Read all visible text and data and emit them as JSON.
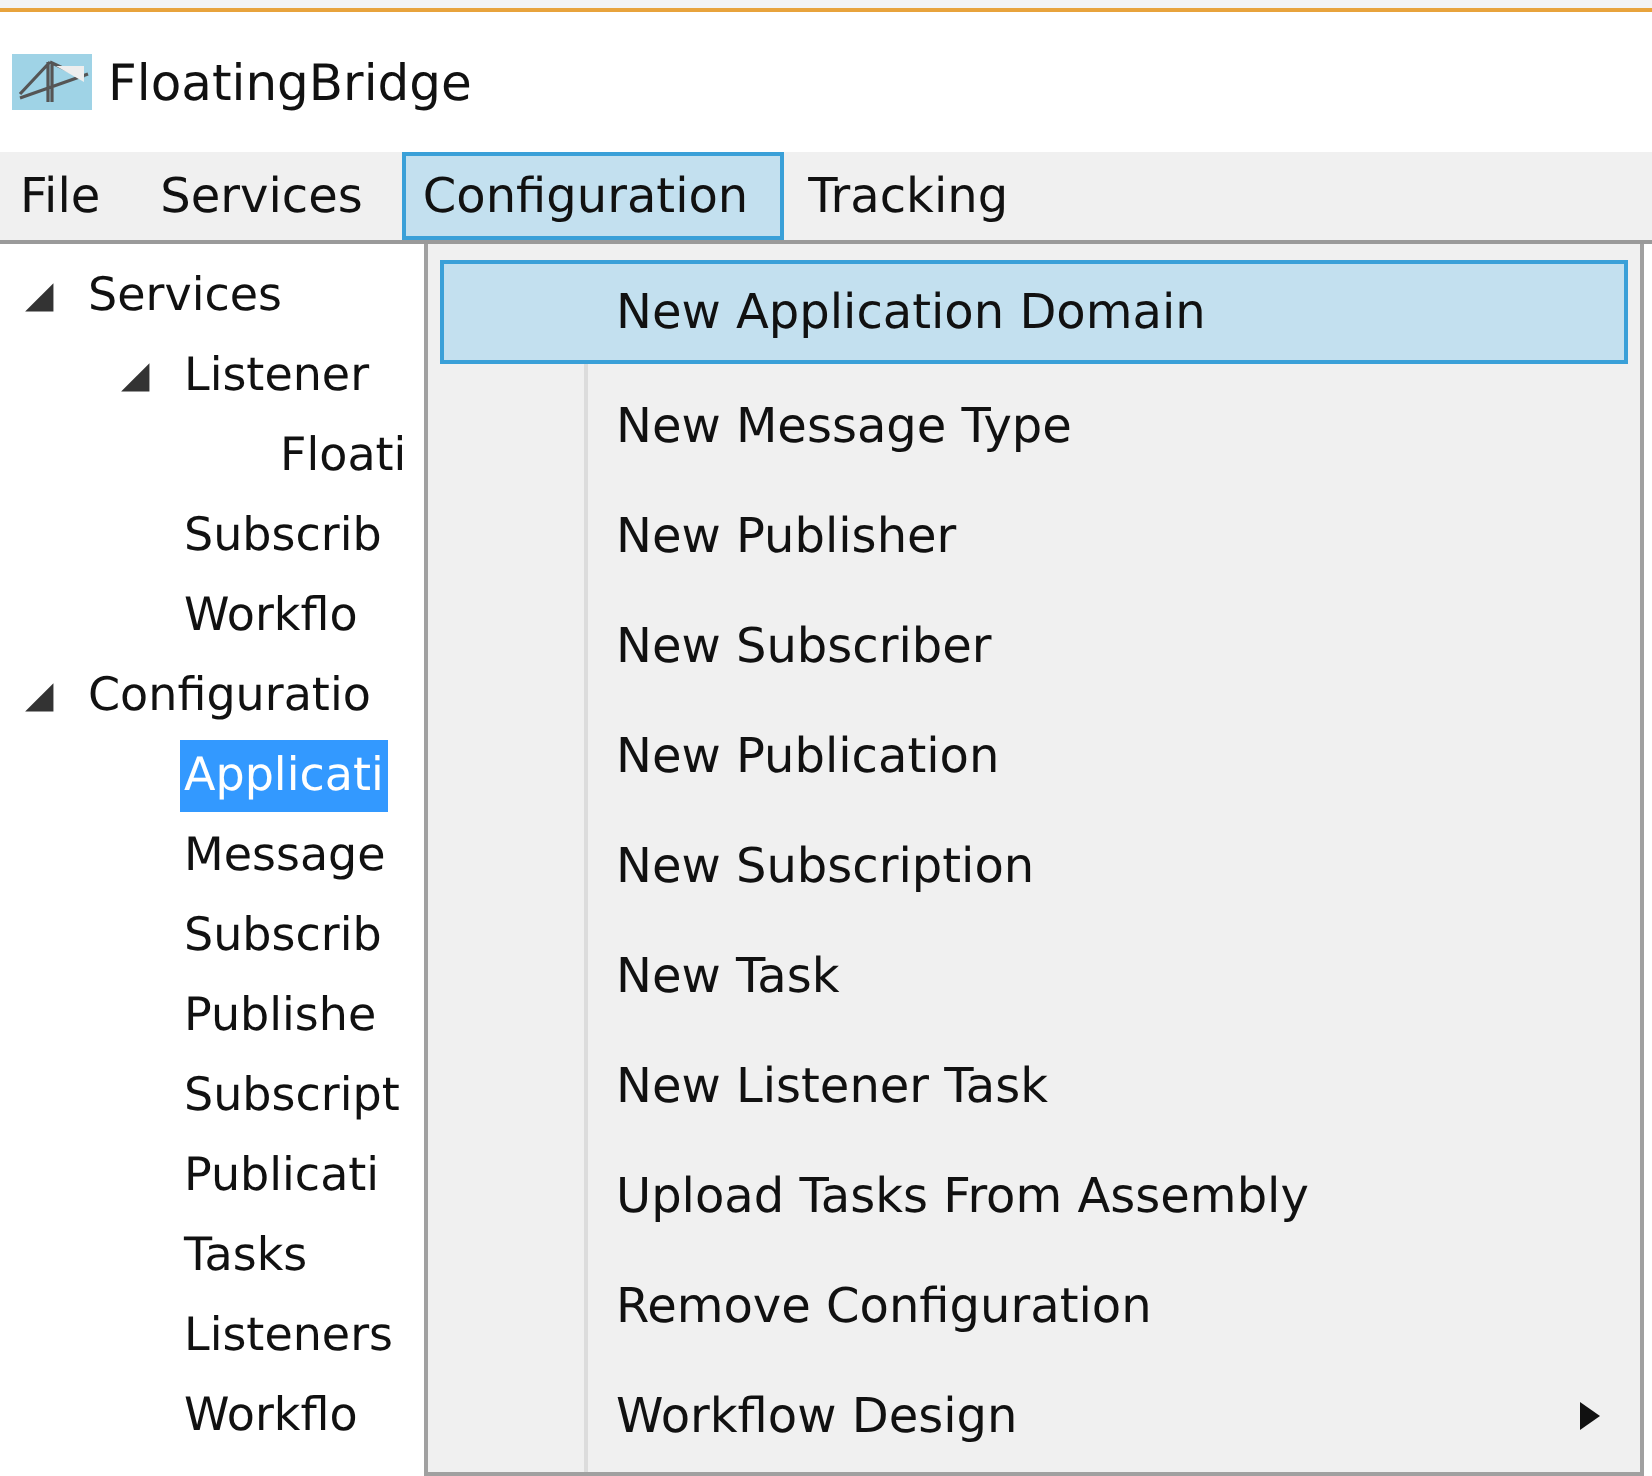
{
  "window": {
    "title": "FloatingBridge"
  },
  "menu_bar": [
    {
      "label": "File",
      "selected": false
    },
    {
      "label": "Services",
      "selected": false
    },
    {
      "label": "Configuration",
      "selected": true
    },
    {
      "label": "Tracking",
      "selected": false
    }
  ],
  "tree": [
    {
      "label": "Services",
      "expanded": true,
      "selected": false,
      "children": [
        {
          "label": "Listener",
          "expanded": true,
          "selected": false,
          "children": [
            {
              "label": "Floati",
              "selected": false
            }
          ]
        },
        {
          "label": "Subscrib",
          "selected": false
        },
        {
          "label": "Workflo",
          "selected": false
        }
      ]
    },
    {
      "label": "Configuratio",
      "expanded": true,
      "selected": false,
      "children": [
        {
          "label": "Applicati",
          "selected": true
        },
        {
          "label": "Message",
          "selected": false
        },
        {
          "label": "Subscrib",
          "selected": false
        },
        {
          "label": "Publishe",
          "selected": false
        },
        {
          "label": "Subscript",
          "selected": false
        },
        {
          "label": "Publicati",
          "selected": false
        },
        {
          "label": "Tasks",
          "selected": false
        },
        {
          "label": "Listeners",
          "selected": false
        },
        {
          "label": "Workflo",
          "selected": false
        }
      ]
    }
  ],
  "dropdown": [
    {
      "label": "New Application Domain",
      "kind": "item",
      "selected": true
    },
    {
      "label": "New Message Type",
      "kind": "item",
      "selected": false
    },
    {
      "label": "New Publisher",
      "kind": "item",
      "selected": false
    },
    {
      "label": "New Subscriber",
      "kind": "item",
      "selected": false
    },
    {
      "label": "New Publication",
      "kind": "item",
      "selected": false
    },
    {
      "label": "New Subscription",
      "kind": "item",
      "selected": false
    },
    {
      "label": "New Task",
      "kind": "item",
      "selected": false
    },
    {
      "label": "New Listener Task",
      "kind": "item",
      "selected": false
    },
    {
      "label": "Upload Tasks From Assembly",
      "kind": "item",
      "selected": false
    },
    {
      "label": "Remove Configuration",
      "kind": "item",
      "selected": false
    },
    {
      "label": "Workflow Design",
      "kind": "submenu",
      "selected": false
    }
  ]
}
